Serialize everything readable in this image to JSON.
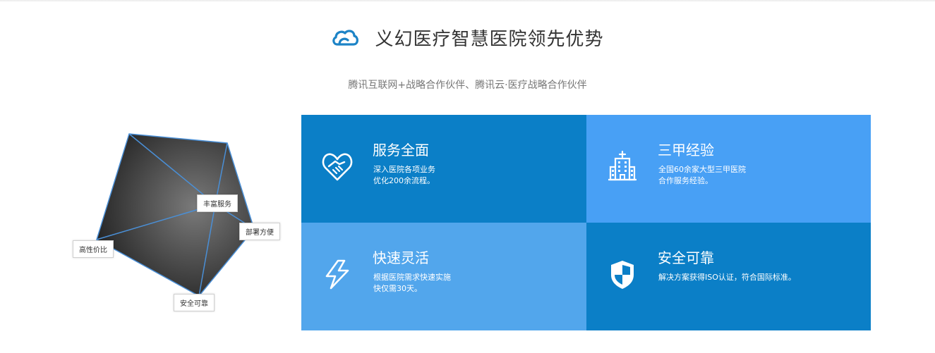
{
  "header": {
    "title": "义幻医疗智慧医院领先优势",
    "subtitle": "腾讯互联网+战略合作伙伴、腾讯云·医疗战略合作伙伴",
    "icon": "cloud-icon"
  },
  "diagram": {
    "labels": {
      "rich_service": "丰富服务",
      "easy_deploy": "部署方便",
      "cost_effective": "高性价比",
      "secure_reliable": "安全可靠"
    }
  },
  "features": [
    {
      "title": "服务全面",
      "line1": "深入医院各项业务",
      "line2": "优化200余流程。",
      "icon": "handshake-heart-icon",
      "color": "#0b7fc7"
    },
    {
      "title": "三甲经验",
      "line1": "全国60余家大型三甲医院",
      "line2": "合作服务经验。",
      "icon": "hospital-icon",
      "color": "#48a0f5"
    },
    {
      "title": "快速灵活",
      "line1": "根据医院需求快速实施",
      "line2": "快仅需30天。",
      "icon": "lightning-icon",
      "color": "#52a6ec"
    },
    {
      "title": "安全可靠",
      "line1": "解决方案获得ISO认证，符合国际标准。",
      "line2": "",
      "icon": "shield-icon",
      "color": "#0b7fc7"
    }
  ]
}
